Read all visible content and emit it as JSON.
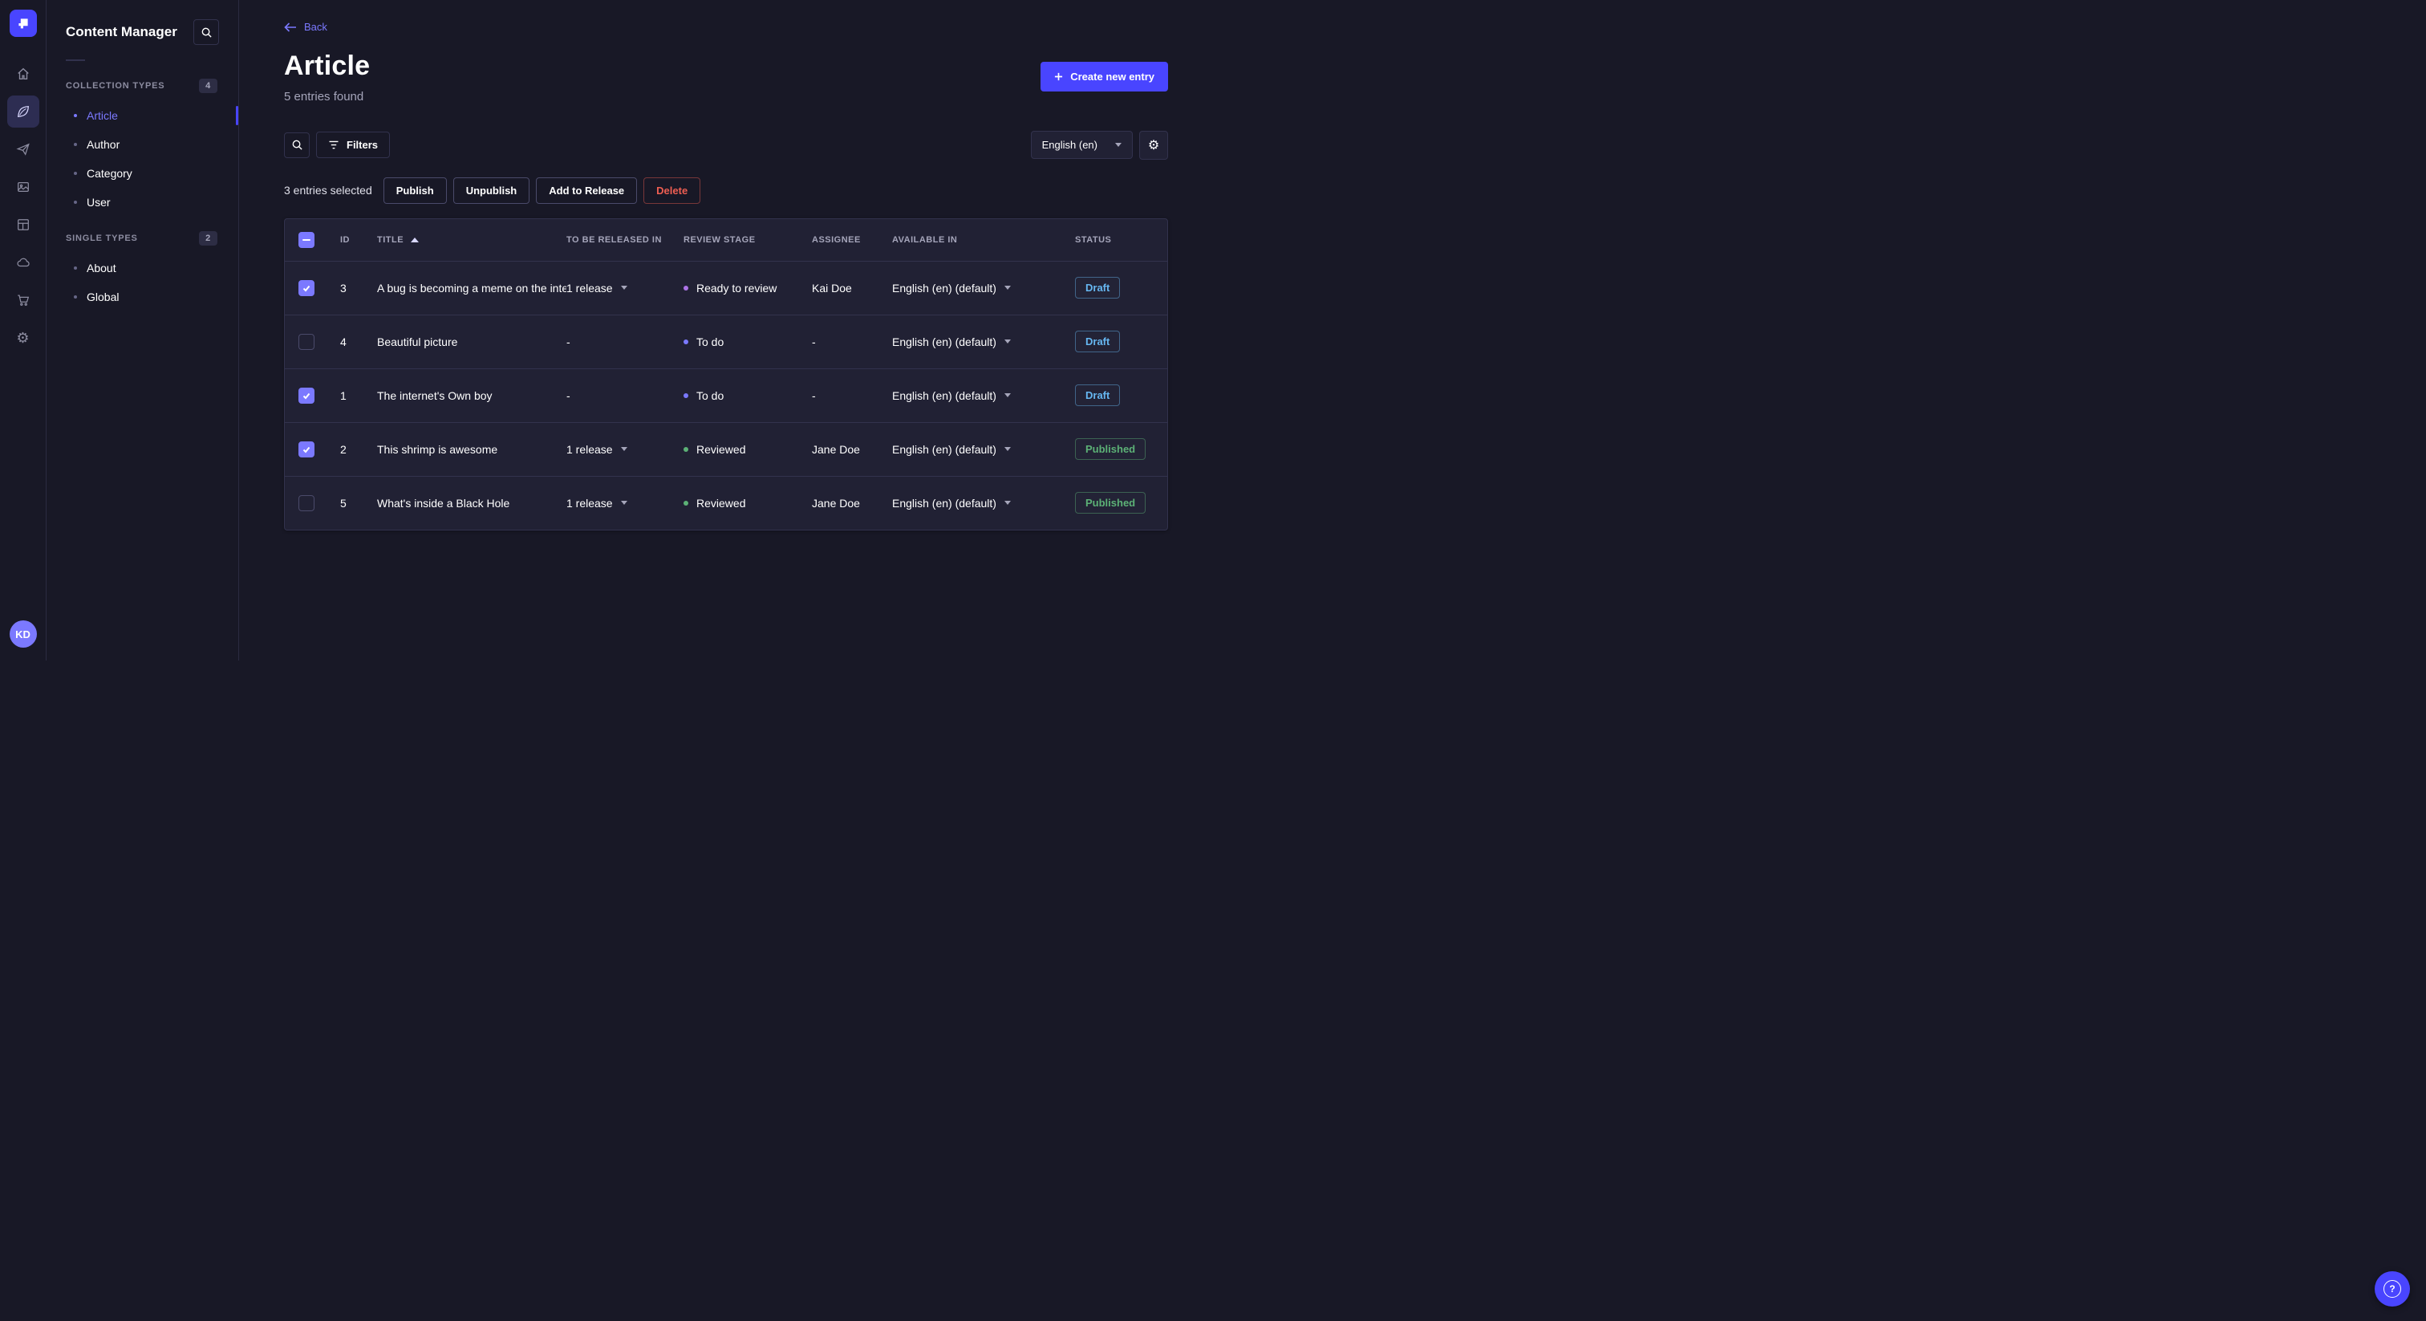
{
  "app": {
    "avatar": "KD"
  },
  "colors": {
    "primary": "#4945ff",
    "primary_light": "#7b79ff",
    "stages": {
      "Ready to review": "#ac73e6",
      "To do": "#7b79ff",
      "Reviewed": "#5cb176"
    },
    "status": {
      "Draft": "#66b7f1",
      "Published": "#5cb176"
    }
  },
  "rail_icons": [
    "home",
    "content-manager",
    "releases",
    "media-library",
    "content-type-builder",
    "cloud",
    "marketplace",
    "settings"
  ],
  "sidebar": {
    "title": "Content Manager",
    "sections": [
      {
        "label": "COLLECTION TYPES",
        "badge": "4",
        "items": [
          {
            "label": "Article",
            "active": true
          },
          {
            "label": "Author",
            "active": false
          },
          {
            "label": "Category",
            "active": false
          },
          {
            "label": "User",
            "active": false
          }
        ]
      },
      {
        "label": "SINGLE TYPES",
        "badge": "2",
        "items": [
          {
            "label": "About",
            "active": false
          },
          {
            "label": "Global",
            "active": false
          }
        ]
      }
    ]
  },
  "header": {
    "back": "Back",
    "title": "Article",
    "subtitle": "5 entries found",
    "create_button": "Create new entry"
  },
  "toolbar": {
    "filters": "Filters",
    "locale": "English (en)",
    "selected_text": "3 entries selected",
    "actions": [
      "Publish",
      "Unpublish",
      "Add to Release",
      "Delete"
    ]
  },
  "table": {
    "select_all": "indeterminate",
    "headers": [
      "ID",
      "TITLE",
      "TO BE RELEASED IN",
      "REVIEW STAGE",
      "ASSIGNEE",
      "AVAILABLE IN",
      "STATUS"
    ],
    "rows": [
      {
        "checked": true,
        "id": "3",
        "title": "A bug is becoming a meme on the internet",
        "release": "1 release",
        "stage": "Ready to review",
        "assignee": "Kai Doe",
        "locale": "English (en) (default)",
        "status": "Draft"
      },
      {
        "checked": false,
        "id": "4",
        "title": "Beautiful picture",
        "release": "-",
        "stage": "To do",
        "assignee": "-",
        "locale": "English (en) (default)",
        "status": "Draft"
      },
      {
        "checked": true,
        "id": "1",
        "title": "The internet's Own boy",
        "release": "-",
        "stage": "To do",
        "assignee": "-",
        "locale": "English (en) (default)",
        "status": "Draft"
      },
      {
        "checked": true,
        "id": "2",
        "title": "This shrimp is awesome",
        "release": "1 release",
        "stage": "Reviewed",
        "assignee": "Jane Doe",
        "locale": "English (en) (default)",
        "status": "Published"
      },
      {
        "checked": false,
        "id": "5",
        "title": "What's inside a Black Hole",
        "release": "1 release",
        "stage": "Reviewed",
        "assignee": "Jane Doe",
        "locale": "English (en) (default)",
        "status": "Published"
      }
    ]
  },
  "help": {
    "label": "?"
  }
}
